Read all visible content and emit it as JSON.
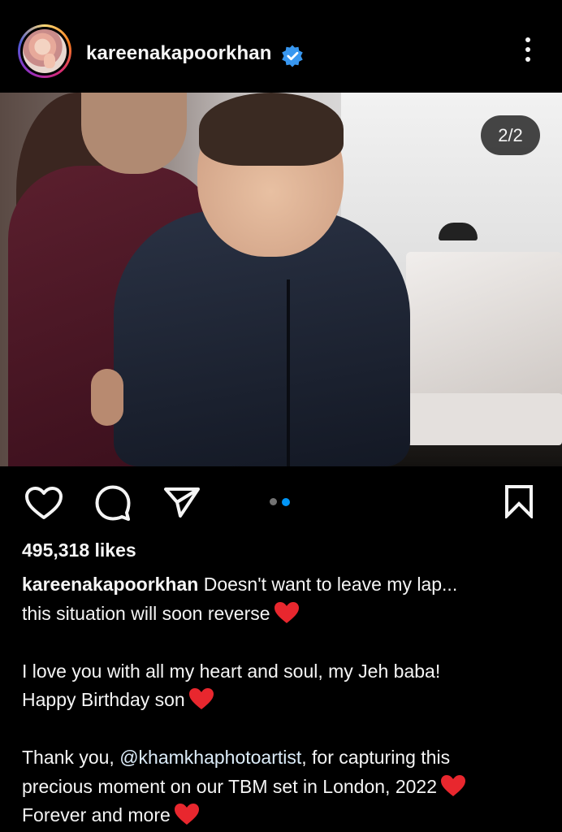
{
  "header": {
    "username": "kareenakapoorkhan",
    "verified_icon": "verified-badge-icon",
    "more_icon": "more-vertical-icon"
  },
  "post": {
    "image_counter": "2/2",
    "carousel": {
      "current": 2,
      "total": 2
    }
  },
  "actions": {
    "like_icon": "heart-outline-icon",
    "comment_icon": "comment-bubble-icon",
    "share_icon": "send-paper-plane-icon",
    "save_icon": "bookmark-outline-icon"
  },
  "likes": "495,318 likes",
  "caption": {
    "author": "kareenakapoorkhan",
    "line1_text": " Doesn't want to leave my lap...",
    "line2_text": "this situation will soon reverse",
    "line3_text": "I love you with all my heart and soul, my Jeh baba!",
    "line4_text": "Happy Birthday son",
    "line5_prefix": "Thank you, ",
    "line5_mention": "@khamkhaphotoartist",
    "line5_suffix": ", for capturing this",
    "line6_text": "precious moment on our TBM set in London, 2022",
    "line7_text": "Forever and more",
    "emoji": "red-heart-emoji"
  },
  "colors": {
    "background": "#000000",
    "text": "#f5f5f5",
    "verified_blue": "#3897f0",
    "carousel_active": "#0095f6",
    "heart_red": "#e8272e"
  }
}
